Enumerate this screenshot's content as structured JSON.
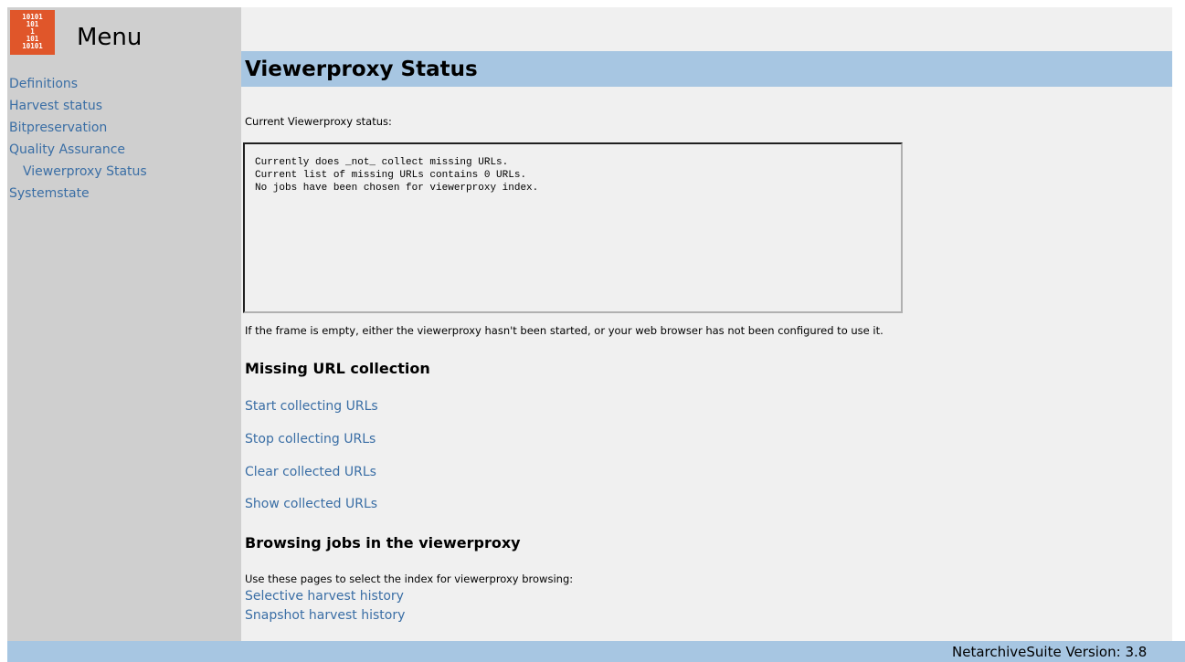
{
  "sidebar": {
    "logo_lines": "10101\n 101 \n  1  \n 101 \n10101",
    "menu_title": "Menu",
    "items": [
      {
        "label": "Definitions"
      },
      {
        "label": "Harvest status"
      },
      {
        "label": "Bitpreservation"
      },
      {
        "label": "Quality Assurance"
      },
      {
        "label": "Viewerproxy Status"
      },
      {
        "label": "Systemstate"
      }
    ]
  },
  "main": {
    "page_title": "Viewerproxy Status",
    "status_intro": "Current Viewerproxy status:",
    "status_lines": "Currently does _not_ collect missing URLs.\nCurrent list of missing URLs contains 0 URLs.\nNo jobs have been chosen for viewerproxy index.",
    "frame_note": "If the frame is empty, either the viewerproxy hasn't been started, or your web browser has not been configured to use it.",
    "missing_heading": "Missing URL collection",
    "links": {
      "start_collecting": "Start collecting URLs",
      "stop_collecting": "Stop collecting URLs",
      "clear_collected": "Clear collected URLs",
      "show_collected": "Show collected URLs"
    },
    "browsing_heading": "Browsing jobs in the viewerproxy",
    "browsing_intro": "Use these pages to select the index for viewerproxy browsing:",
    "history_links": {
      "selective": "Selective harvest history",
      "snapshot": "Snapshot harvest history"
    }
  },
  "footer": {
    "version": "NetarchiveSuite Version: 3.8"
  },
  "colors": {
    "link": "#3a6ea5",
    "title_bar": "#a7c6e2",
    "sidebar_bg": "#cfcfcf",
    "logo_bg": "#e0562a",
    "main_bg": "#f0f0f0"
  }
}
